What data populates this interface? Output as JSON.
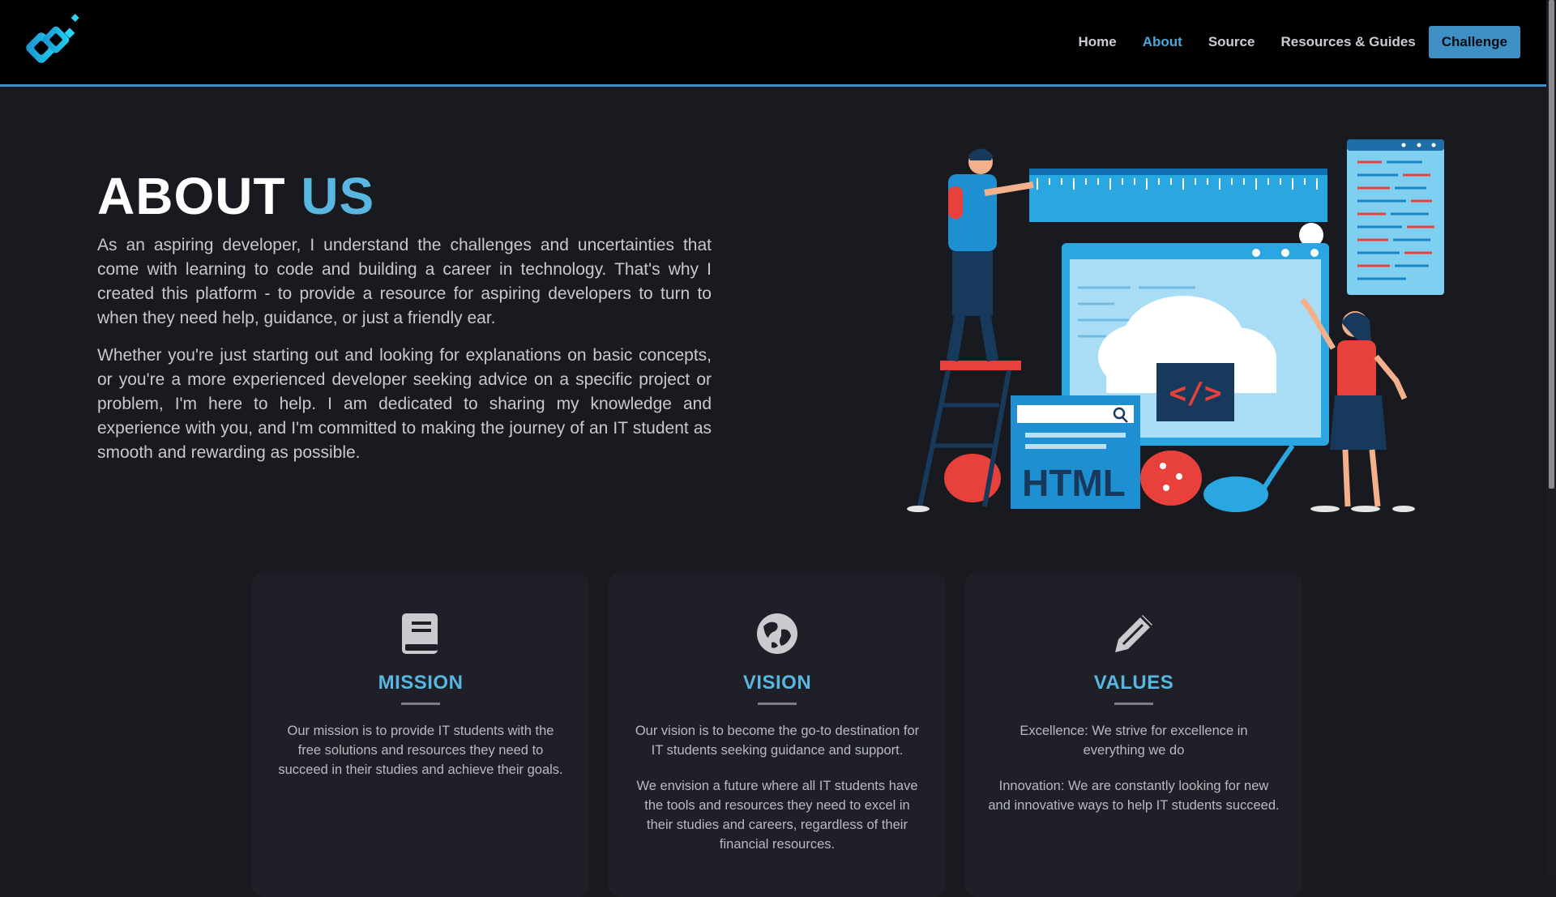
{
  "nav": {
    "links": [
      "Home",
      "About",
      "Source",
      "Resources & Guides"
    ],
    "cta": "Challenge"
  },
  "hero": {
    "title_main": "ABOUT",
    "title_accent": "US",
    "paragraphs": [
      "As an aspiring developer, I understand the challenges and uncertainties that come with learning to code and building a career in technology. That's why I created this platform - to provide a resource for aspiring developers to turn to when they need help, guidance, or just a friendly ear.",
      "Whether you're just starting out and looking for explanations on basic concepts, or you're a more experienced developer seeking advice on a specific project or problem, I'm here to help. I am dedicated to sharing my knowledge and experience with you, and I'm committed to making the journey of an IT student as smooth and rewarding as possible."
    ],
    "illustration": {
      "label": "HTML"
    }
  },
  "cards": [
    {
      "icon": "book-icon",
      "title": "MISSION",
      "paragraphs": [
        "Our mission is to provide IT students with the free solutions and resources they need to succeed in their studies and achieve their goals."
      ]
    },
    {
      "icon": "globe-icon",
      "title": "VISION",
      "paragraphs": [
        "Our vision is to become the go-to destination for IT students seeking guidance and support.",
        "We envision a future where all IT students have the tools and resources they need to excel in their studies and careers, regardless of their financial resources."
      ]
    },
    {
      "icon": "pencil-icon",
      "title": "VALUES",
      "paragraphs": [
        "Excellence: We strive for excellence in everything we do",
        "Innovation: We are constantly looking for new and innovative ways to help IT students succeed."
      ]
    }
  ],
  "colors": {
    "accent": "#59b6e0",
    "nav_border": "#3d8fc4",
    "background": "#181a20",
    "card": "#1f2027"
  }
}
